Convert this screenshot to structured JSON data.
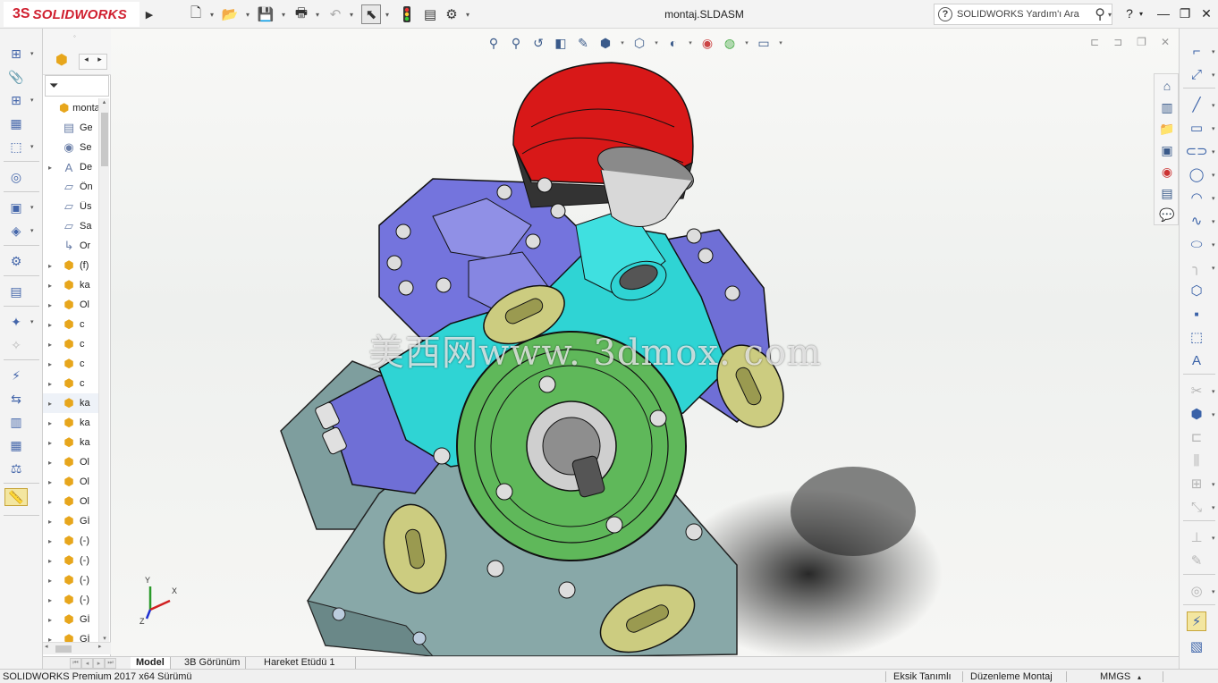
{
  "app": {
    "logo_mark": "3S",
    "logo_text": "SOLIDWORKS",
    "document_title": "montaj.SLDASM",
    "help_search_placeholder": "SOLIDWORKS Yardım'ı Ara"
  },
  "feature_tree": {
    "items": [
      {
        "label": "montaj",
        "icon": "assembly-icon",
        "expandable": false
      },
      {
        "label": "Ge",
        "icon": "history-icon",
        "expandable": false
      },
      {
        "label": "Se",
        "icon": "sensor-icon",
        "expandable": false
      },
      {
        "label": "De",
        "icon": "annotations-icon",
        "expandable": true
      },
      {
        "label": "Ön",
        "icon": "plane-icon",
        "expandable": false
      },
      {
        "label": "Üs",
        "icon": "plane-icon",
        "expandable": false
      },
      {
        "label": "Sa",
        "icon": "plane-icon",
        "expandable": false
      },
      {
        "label": "Or",
        "icon": "origin-icon",
        "expandable": false
      },
      {
        "label": "(f)",
        "icon": "part-icon",
        "expandable": true
      },
      {
        "label": "ka",
        "icon": "part-icon",
        "expandable": true
      },
      {
        "label": "Ol",
        "icon": "part-icon",
        "expandable": true
      },
      {
        "label": "c",
        "icon": "part-icon",
        "expandable": true
      },
      {
        "label": "c",
        "icon": "part-icon",
        "expandable": true
      },
      {
        "label": "c",
        "icon": "part-icon",
        "expandable": true
      },
      {
        "label": "c",
        "icon": "part-icon",
        "expandable": true
      },
      {
        "label": "ka",
        "icon": "part-icon",
        "expandable": true
      },
      {
        "label": "ka",
        "icon": "part-icon",
        "expandable": true
      },
      {
        "label": "ka",
        "icon": "part-icon",
        "expandable": true
      },
      {
        "label": "Ol",
        "icon": "part-icon",
        "expandable": true
      },
      {
        "label": "Ol",
        "icon": "part-icon",
        "expandable": true
      },
      {
        "label": "Ol",
        "icon": "part-icon",
        "expandable": true
      },
      {
        "label": "Gİ",
        "icon": "part-icon",
        "expandable": true
      },
      {
        "label": "(-)",
        "icon": "part-icon",
        "expandable": true
      },
      {
        "label": "(-)",
        "icon": "part-icon",
        "expandable": true
      },
      {
        "label": "(-)",
        "icon": "part-icon",
        "expandable": true
      },
      {
        "label": "(-)",
        "icon": "part-icon",
        "expandable": true
      },
      {
        "label": "Gİ",
        "icon": "part-icon",
        "expandable": true
      },
      {
        "label": "Gİ",
        "icon": "part-icon",
        "expandable": true
      }
    ]
  },
  "graphics": {
    "watermark": "美西网www. 3dmox. com",
    "triad": {
      "x": "X",
      "y": "Y",
      "z": "Z"
    }
  },
  "bottom_tabs": {
    "model": "Model",
    "view3d": "3B Görünüm",
    "motion": "Hareket Etüdü 1"
  },
  "status_bar": {
    "version": "SOLIDWORKS Premium 2017 x64 Sürümü",
    "definition": "Eksik Tanımlı",
    "mode": "Düzenleme Montaj",
    "units": "MMGS"
  },
  "colors": {
    "brand_red": "#d02030",
    "housing_blue": "#6f6fd6",
    "body_cyan": "#2fd4d4",
    "cover_green": "#5fb85a",
    "cap_red": "#d81818",
    "base_gray": "#7e9e9e",
    "selection_yellow": "#f3e6a0"
  }
}
